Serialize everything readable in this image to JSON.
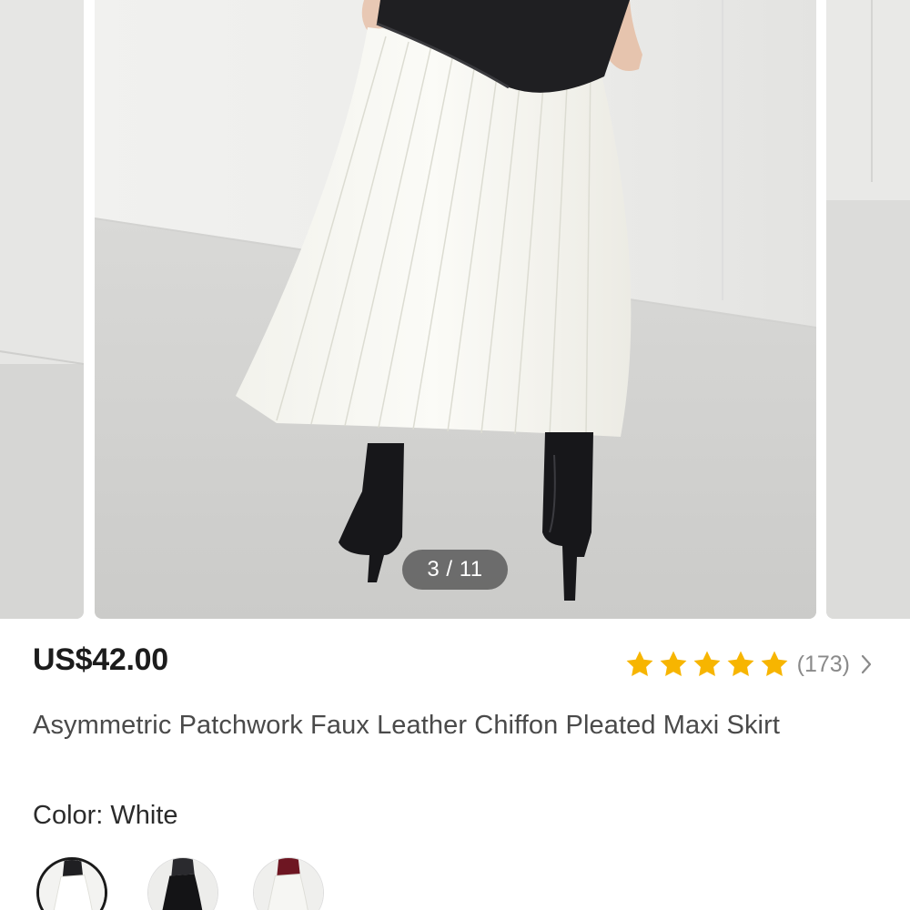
{
  "gallery": {
    "counter": "3 / 11",
    "current_index": 3,
    "total": 11
  },
  "product": {
    "price": "US$42.00",
    "rating_stars": 5,
    "reviews_count": "(173)",
    "title": "Asymmetric Patchwork Faux Leather Chiffon Pleated Maxi Skirt",
    "color_label": "Color: White",
    "colors": [
      "White",
      "Black",
      "Burgundy"
    ],
    "selected_color_index": 0
  },
  "colors": {
    "star": "#F7B500",
    "price_text": "#1C1C1C",
    "muted_text": "#8A8A8A",
    "selected_border": "#1A1A1A"
  },
  "icons": {
    "rating_star": "star-icon",
    "reviews_arrow": "chevron-right-icon"
  }
}
